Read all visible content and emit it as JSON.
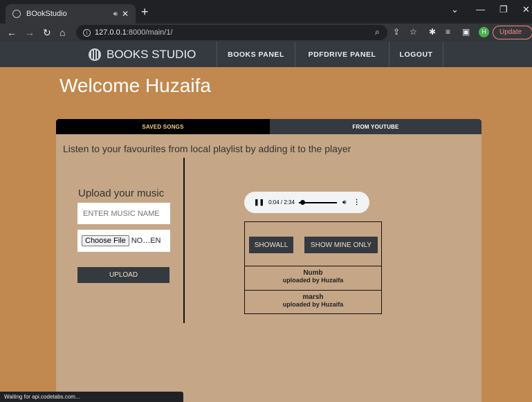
{
  "browser": {
    "tab_title": "BOokStudio",
    "audio_icon": "speaker-icon",
    "close_glyph": "✕",
    "new_tab_glyph": "+",
    "url_host": "127.0.0.1",
    "url_path": ":8000/main/1/",
    "avatar_letter": "H",
    "update_label": "Update",
    "status_text": "Waiting for api.codetabs.com..."
  },
  "navbar": {
    "brand": "BOOKS STUDIO",
    "links": [
      "BOOKS PANEL",
      "PDFDRIVE PANEL",
      "LOGOUT"
    ]
  },
  "page": {
    "welcome": "Welcome Huzaifa",
    "tabs": [
      "SAVED SONGS",
      "FROM YOUTUBE"
    ],
    "intro": "Listen to your favourites from local playlist by adding it to the player"
  },
  "upload": {
    "title": "Upload your music",
    "name_placeholder": "ENTER MUSIC NAME",
    "choose_file": "Choose File",
    "file_status": "NO…EN",
    "upload_label": "UPLOAD"
  },
  "player": {
    "time": "0:04 / 2:34",
    "progress": 0.03
  },
  "songs": {
    "show_all": "SHOWALL",
    "show_mine": "SHOW MINE ONLY",
    "items": [
      {
        "name": "Numb",
        "uploader": "uploaded by Huzaifa"
      },
      {
        "name": "marsh",
        "uploader": "uploaded by Huzaifa"
      }
    ]
  },
  "colors": {
    "page_bg": "#c1884f",
    "panel_bg": "#c5a686",
    "nav_bg": "#343a40"
  }
}
